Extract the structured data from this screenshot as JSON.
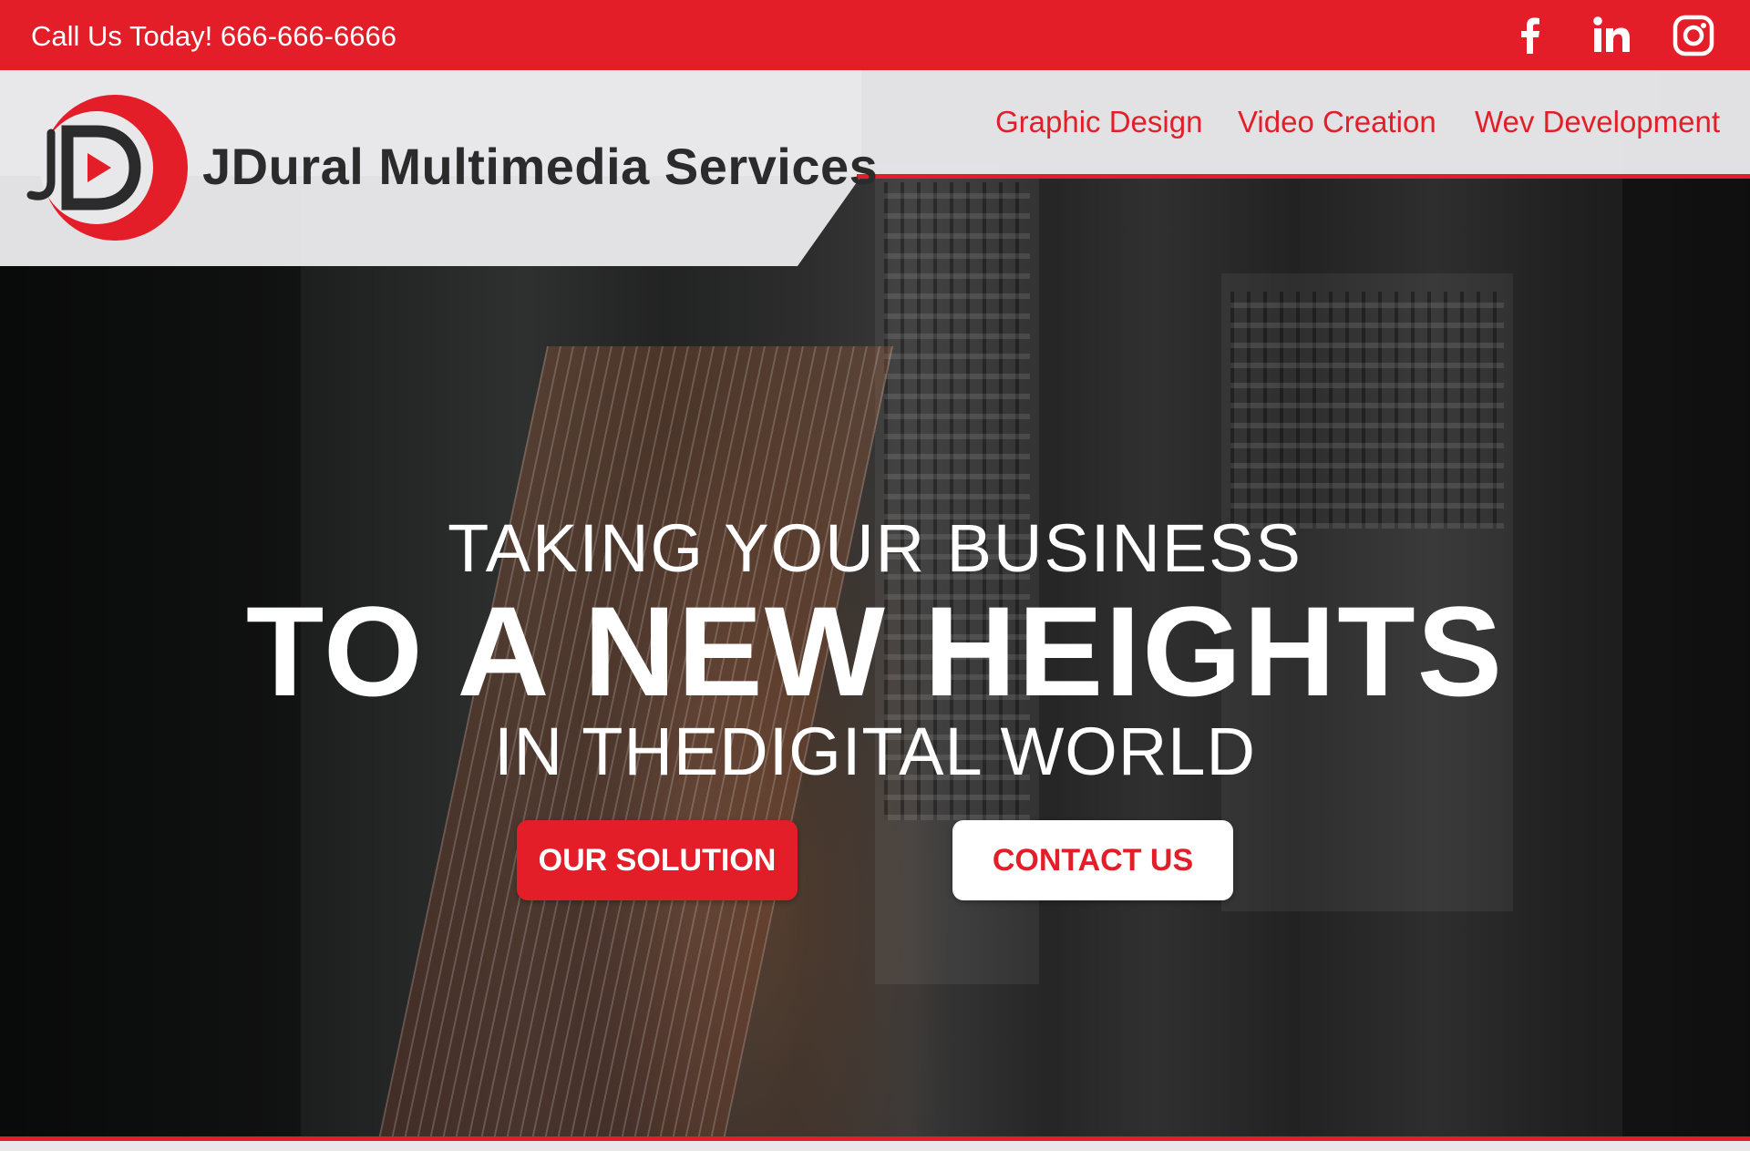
{
  "topbar": {
    "phone_text": "Call Us Today! 666-666-6666",
    "social": [
      {
        "name": "facebook-icon"
      },
      {
        "name": "linkedin-icon"
      },
      {
        "name": "instagram-icon"
      }
    ]
  },
  "header": {
    "logo_initials": "JD",
    "brand_name": "JDural Multimedia Services",
    "nav": [
      {
        "label": "Graphic Design"
      },
      {
        "label": "Video Creation"
      },
      {
        "label": "Wev Development"
      }
    ]
  },
  "hero": {
    "line1": "TAKING YOUR BUSINESS",
    "line2": "TO A NEW HEIGHTS",
    "line3": "IN THEDIGITAL WORLD",
    "primary_button": "OUR SOLUTION",
    "secondary_button": "CONTACT US"
  },
  "colors": {
    "accent": "#e31e28",
    "header_bg": "#e8e8ea",
    "brand_text": "#2b2b2b",
    "white": "#ffffff"
  }
}
